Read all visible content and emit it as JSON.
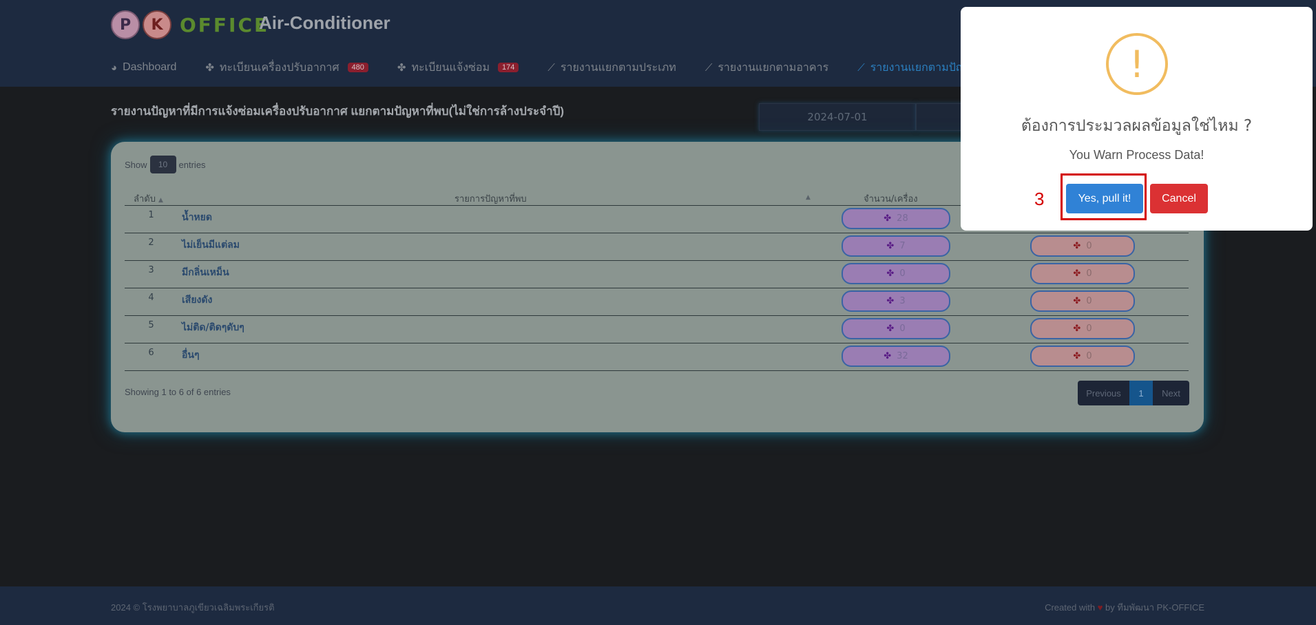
{
  "app": {
    "logo_letters": [
      "P",
      "K"
    ],
    "logo_word": "OFFICE",
    "title": "Air-Conditioner"
  },
  "nav": {
    "items": [
      {
        "label": "Dashboard",
        "icon": "pie-chart-icon",
        "badge": ""
      },
      {
        "label": "ทะเบียนเครื่องปรับอากาศ",
        "icon": "fan-icon",
        "badge": "480"
      },
      {
        "label": "ทะเบียนแจ้งซ่อม",
        "icon": "fan-icon",
        "badge": "174"
      },
      {
        "label": "รายงานแยกตามประเภท",
        "icon": "line-chart-icon",
        "badge": ""
      },
      {
        "label": "รายงานแยกตามอาคาร",
        "icon": "line-chart-icon",
        "badge": ""
      },
      {
        "label": "รายงานแยกตามปัญหา",
        "icon": "line-chart-icon",
        "badge": ""
      }
    ],
    "active_index": 5
  },
  "page": {
    "heading": "รายงานปัญหาที่มีการแจ้งซ่อมเครื่องปรับอากาศ แยกตามปัญหาที่พบ(ไม่ใช่การล้างประจำปี)",
    "date_start": "2024-07-01"
  },
  "table": {
    "show_label": "Show",
    "entries_value": "10",
    "entries_label": "entries",
    "columns": [
      "ลำดับ",
      "รายการปัญหาที่พบ",
      "จำนวน/เครื่อง"
    ],
    "rows": [
      {
        "no": "1",
        "name": "น้ำหยด",
        "count": "28",
        "count2": ""
      },
      {
        "no": "2",
        "name": "ไม่เย็นมีแต่ลม",
        "count": "7",
        "count2": "0"
      },
      {
        "no": "3",
        "name": "มีกลิ่นเหม็น",
        "count": "0",
        "count2": "0"
      },
      {
        "no": "4",
        "name": "เสียงดัง",
        "count": "3",
        "count2": "0"
      },
      {
        "no": "5",
        "name": "ไม่ติด/ติดๆดับๆ",
        "count": "0",
        "count2": "0"
      },
      {
        "no": "6",
        "name": "อื่นๆ",
        "count": "32",
        "count2": "0"
      }
    ],
    "info": "Showing 1 to 6 of 6 entries",
    "pager": {
      "previous": "Previous",
      "current": "1",
      "next": "Next"
    }
  },
  "footer": {
    "left": "2024 © โรงพยาบาลภูเขียวเฉลิมพระเกียรติ",
    "right_prefix": "Created with",
    "right_by": "by",
    "right_team": "ทีมพัฒนา PK-OFFICE"
  },
  "dialog": {
    "icon": "warning-icon",
    "icon_glyph": "!",
    "title": "ต้องการประมวลผลข้อมูลใช่ไหม ?",
    "text": "You Warn Process Data!",
    "confirm": "Yes, pull it!",
    "cancel": "Cancel"
  },
  "annotation": {
    "step_number": "3"
  },
  "colors": {
    "header_bg": "#1d2a40",
    "card_bg": "#8a9590",
    "warning": "#f1bc5f",
    "confirm": "#3082d6",
    "cancel": "#db3133",
    "annotation": "#d40000"
  }
}
